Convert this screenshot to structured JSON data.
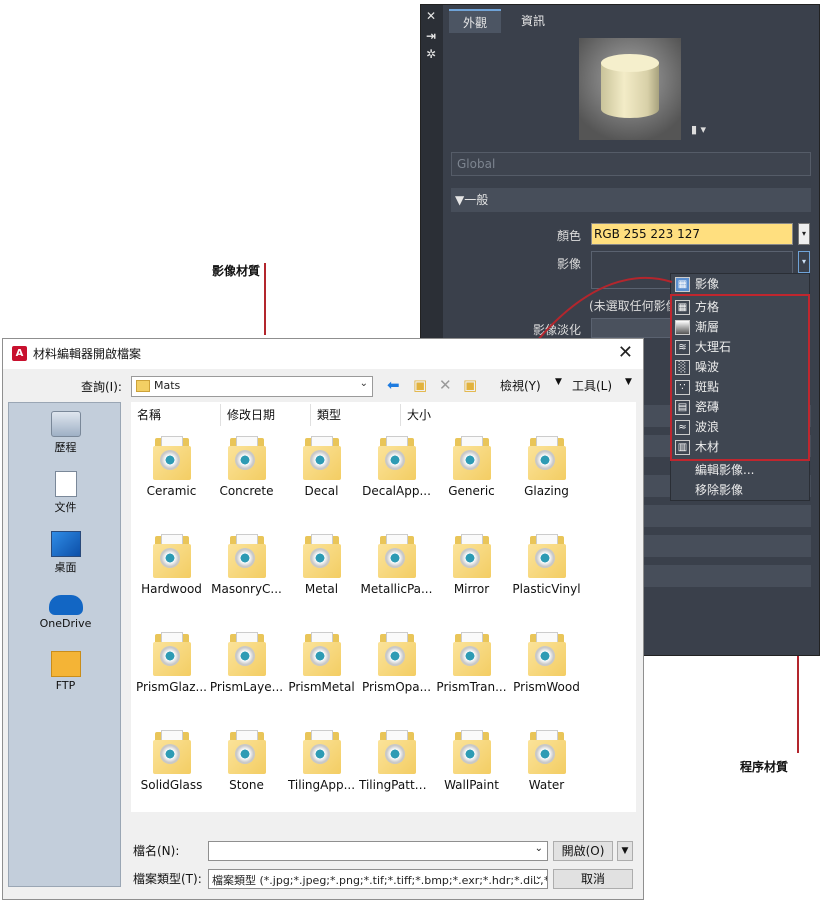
{
  "callouts": {
    "image_material": "影像材質",
    "procedural_material": "程序材質"
  },
  "panel": {
    "side_icons": [
      "✕",
      "⇥",
      "✲"
    ],
    "tabs": [
      {
        "label": "外觀"
      },
      {
        "label": "資訊"
      }
    ],
    "global_field": "Global",
    "general_header": "▼一般",
    "color_label": "顏色",
    "color_value": "RGB 255 223 127",
    "image_label": "影像",
    "no_image_text": "(未選取任何影像",
    "fade_label": "影像淡化",
    "accent_color": "#ffdf7f"
  },
  "menu": {
    "items": [
      {
        "label": "影像",
        "icon": "image-icon"
      },
      {
        "label": "方格",
        "icon": "checker-icon"
      },
      {
        "label": "漸層",
        "icon": "gradient-icon"
      },
      {
        "label": "大理石",
        "icon": "marble-icon"
      },
      {
        "label": "噪波",
        "icon": "noise-icon"
      },
      {
        "label": "斑點",
        "icon": "speckle-icon"
      },
      {
        "label": "瓷磚",
        "icon": "tiles-icon"
      },
      {
        "label": "波浪",
        "icon": "waves-icon"
      },
      {
        "label": "木材",
        "icon": "wood-icon"
      }
    ],
    "edit_image": "編輯影像...",
    "remove_image": "移除影像"
  },
  "dialog": {
    "title": "材料編輯器開啟檔案",
    "look_in_label": "查詢(I):",
    "look_in_value": "Mats",
    "view_menu": "檢視(Y)",
    "tools_menu": "工具(L)",
    "places": [
      {
        "label": "歷程"
      },
      {
        "label": "文件"
      },
      {
        "label": "桌面"
      },
      {
        "label": "OneDrive"
      },
      {
        "label": "FTP"
      }
    ],
    "columns": [
      "名稱",
      "修改日期",
      "類型",
      "大小"
    ],
    "files": [
      "Ceramic",
      "Concrete",
      "Decal",
      "DecalApp...",
      "Generic",
      "Glazing",
      "Hardwood",
      "MasonryC...",
      "Metal",
      "MetallicPa...",
      "Mirror",
      "PlasticVinyl",
      "PrismGlaz...",
      "PrismLaye...",
      "PrismMetal",
      "PrismOpa...",
      "PrismTran...",
      "PrismWood",
      "SolidGlass",
      "Stone",
      "TilingApp...",
      "TilingPattern",
      "WallPaint",
      "Water"
    ],
    "filename_label": "檔名(N):",
    "filename_value": "",
    "filetype_label": "檔案類型(T):",
    "filetype_value": "檔案類型 (*.jpg;*.jpeg;*.png;*.tif;*.tiff;*.bmp;*.exr;*.hdr;*.dib;*",
    "open_button": "開啟(O)",
    "cancel_button": "取消"
  }
}
